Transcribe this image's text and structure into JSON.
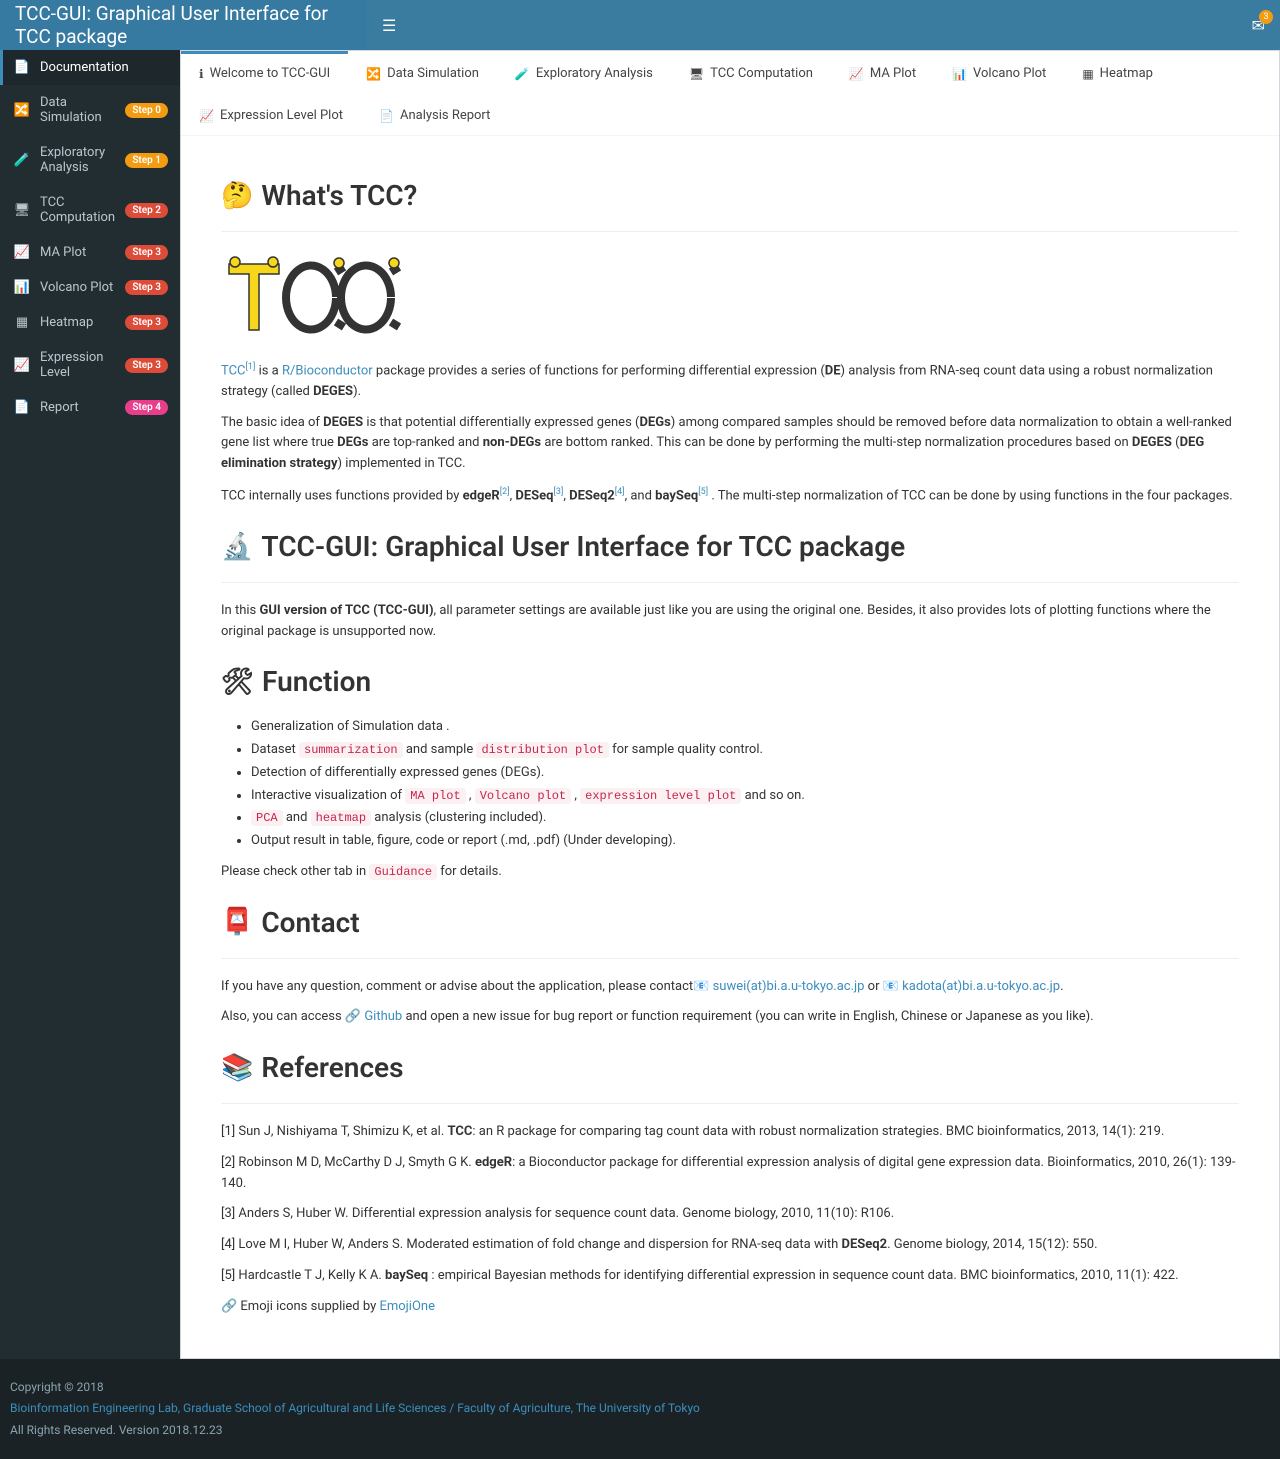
{
  "header": {
    "title": "TCC-GUI: Graphical User Interface for TCC package",
    "msg_count": "3"
  },
  "sidebar": {
    "items": [
      {
        "icon": "📄",
        "label": "Documentation",
        "badge": "",
        "badge_class": ""
      },
      {
        "icon": "🔀",
        "label": "Data Simulation",
        "badge": "Step 0",
        "badge_class": "badge-orange"
      },
      {
        "icon": "🧪",
        "label": "Exploratory Analysis",
        "badge": "Step 1",
        "badge_class": "badge-orange"
      },
      {
        "icon": "🖥",
        "label": "TCC Computation",
        "badge": "Step 2",
        "badge_class": "badge-red"
      },
      {
        "icon": "📈",
        "label": "MA Plot",
        "badge": "Step 3",
        "badge_class": "badge-red"
      },
      {
        "icon": "📊",
        "label": "Volcano Plot",
        "badge": "Step 3",
        "badge_class": "badge-red"
      },
      {
        "icon": "▦",
        "label": "Heatmap",
        "badge": "Step 3",
        "badge_class": "badge-red"
      },
      {
        "icon": "📈",
        "label": "Expression Level",
        "badge": "Step 3",
        "badge_class": "badge-red"
      },
      {
        "icon": "📄",
        "label": "Report",
        "badge": "Step 4",
        "badge_class": "badge-pink"
      }
    ]
  },
  "tabs": [
    {
      "icon": "ℹ",
      "label": "Welcome to TCC-GUI"
    },
    {
      "icon": "🔀",
      "label": "Data Simulation"
    },
    {
      "icon": "🧪",
      "label": "Exploratory Analysis"
    },
    {
      "icon": "🖥",
      "label": "TCC Computation"
    },
    {
      "icon": "📈",
      "label": "MA Plot"
    },
    {
      "icon": "📊",
      "label": "Volcano Plot"
    },
    {
      "icon": "▦",
      "label": "Heatmap"
    },
    {
      "icon": "📈",
      "label": "Expression Level Plot"
    },
    {
      "icon": "📄",
      "label": "Analysis Report"
    }
  ],
  "headings": {
    "whats_tcc": "What's TCC?",
    "gui": "TCC-GUI: Graphical User Interface for TCC package",
    "function": "Function",
    "contact": "Contact",
    "references": "References"
  },
  "intro": {
    "tcc": "TCC",
    "is_a": " is a ",
    "rbio": "R/Bioconductor",
    "p1_rest": " package provides a series of functions for performing differential expression (",
    "de": "DE",
    "p1_rest2": ") analysis from RNA-seq count data using a robust normalization strategy (called ",
    "deges": "DEGES",
    "p1_rest3": ").",
    "p2a": "The basic idea of ",
    "p2b": " is that potential differentially expressed genes (",
    "degs": "DEGs",
    "p2c": ") among compared samples should be removed before data normalization to obtain a well-ranked gene list where true ",
    "p2d": " are top-ranked and ",
    "nondegs": "non-DEGs",
    "p2e": " are bottom ranked. This can be done by performing the multi-step normalization procedures based on ",
    "p2f": " (",
    "deg_elim": "DEG elimination strategy",
    "p2g": ") implemented in TCC.",
    "p3a": "TCC internally uses functions provided by ",
    "edgeR": "edgeR",
    "p3b": ", ",
    "deseq": "DESeq",
    "deseq2": "DESeq2",
    "p3c": ", and ",
    "bayseq": "baySeq",
    "p3d": " . The multi-step normalization of TCC can be done by using functions in the four packages."
  },
  "gui_section": {
    "p1a": "In this ",
    "bold": "GUI version of TCC (TCC-GUI)",
    "p1b": ", all parameter settings are available just like you are using the original one. Besides, it also provides lots of plotting functions where the original package is unsupported now."
  },
  "functions": {
    "f1": "Generalization of Simulation data .",
    "f2a": "Dataset ",
    "f2_code1": "summarization",
    "f2b": " and sample ",
    "f2_code2": "distribution plot",
    "f2c": " for sample quality control.",
    "f3": "Detection of differentially expressed genes (DEGs).",
    "f4a": "Interactive visualization of ",
    "f4_code1": "MA plot",
    "f4b": " , ",
    "f4_code2": "Volcano plot",
    "f4c": " , ",
    "f4_code3": "expression level plot",
    "f4d": " and so on.",
    "f5_code1": "PCA",
    "f5a": " and ",
    "f5_code2": "heatmap",
    "f5b": " analysis (clustering included).",
    "f6": "Output result in table, figure, code or report (.md, .pdf) (Under developing).",
    "check_a": "Please check other tab in ",
    "check_code": "Guidance",
    "check_b": " for details."
  },
  "contact": {
    "p1a": "If you have any question, comment or advise about the application, please contact",
    "email1": "suwei(at)bi.a.u-tokyo.ac.jp",
    "or": " or ",
    "email2": "kadota(at)bi.a.u-tokyo.ac.jp",
    "p1b": ".",
    "p2a": "Also, you can access 🔗 ",
    "github": "Github",
    "p2b": " and open a new issue for bug report or function requirement (you can write in English, Chinese or Japanese as you like)."
  },
  "references": {
    "r1a": "[1] Sun J, Nishiyama T, Shimizu K, et al. ",
    "r1_bold": "TCC",
    "r1b": ": an R package for comparing tag count data with robust normalization strategies. BMC bioinformatics, 2013, 14(1): 219.",
    "r2a": "[2] Robinson M D, McCarthy D J, Smyth G K. ",
    "r2_bold": "edgeR",
    "r2b": ": a Bioconductor package for differential expression analysis of digital gene expression data. Bioinformatics, 2010, 26(1): 139-140.",
    "r3": "[3] Anders S, Huber W. Differential expression analysis for sequence count data. Genome biology, 2010, 11(10): R106.",
    "r4a": "[4] Love M I, Huber W, Anders S. Moderated estimation of fold change and dispersion for RNA-seq data with ",
    "r4_bold": "DESeq2",
    "r4b": ". Genome biology, 2014, 15(12): 550.",
    "r5a": "[5] Hardcastle T J, Kelly K A. ",
    "r5_bold": "baySeq",
    "r5b": " : empirical Bayesian methods for identifying differential expression in sequence count data. BMC bioinformatics, 2010, 11(1): 422.",
    "emoji_a": "🔗 Emoji icons supplied by ",
    "emoji_link": "EmojiOne"
  },
  "footer": {
    "copyright": "Copyright © 2018",
    "lab": "Bioinformation Engineering Lab, Graduate School of Agricultural and Life Sciences / Faculty of Agriculture, The University of Tokyo",
    "rights": "All Rights Reserved. Version 2018.12.23"
  }
}
